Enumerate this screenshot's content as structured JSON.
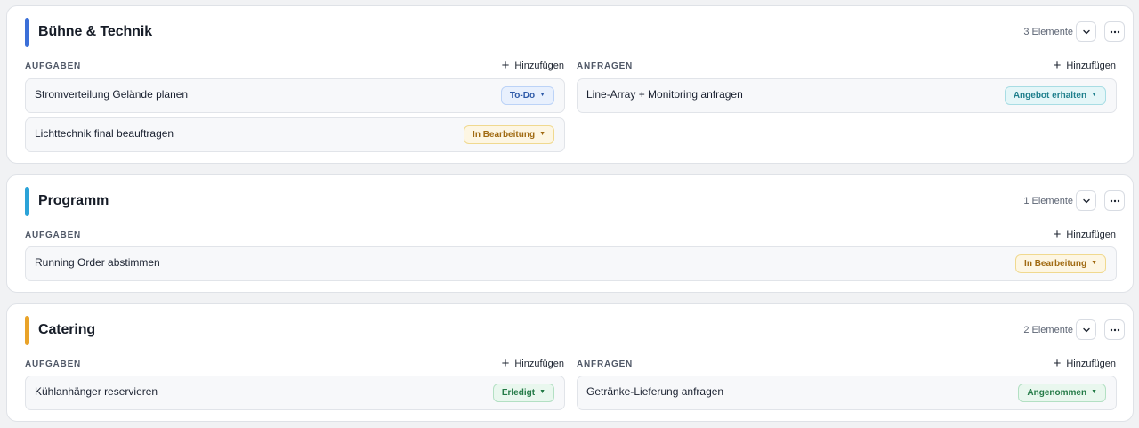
{
  "sections": [
    {
      "title": "Bühne & Technik",
      "accent": "#3b6fd8",
      "count": "3 Elemente",
      "columns": [
        {
          "label": "AUFGABEN",
          "add_label": "Hinzufügen",
          "items": [
            {
              "label": "Stromverteilung Gelände planen",
              "status": "To-Do"
            },
            {
              "label": "Lichttechnik final beauftragen",
              "status": "In Bearbeitung"
            }
          ]
        },
        {
          "label": "ANFRAGEN",
          "add_label": "Hinzufügen",
          "items": [
            {
              "label": "Line-Array + Monitoring anfragen",
              "status": "Angebot erhalten"
            }
          ]
        }
      ]
    },
    {
      "title": "Programm",
      "accent": "#2ba3d8",
      "count": "1 Elemente",
      "columns": [
        {
          "label": "AUFGABEN",
          "add_label": "Hinzufügen",
          "items": [
            {
              "label": "Running Order abstimmen",
              "status": "In Bearbeitung"
            }
          ]
        }
      ]
    },
    {
      "title": "Catering",
      "accent": "#e9a329",
      "count": "2 Elemente",
      "columns": [
        {
          "label": "AUFGABEN",
          "add_label": "Hinzufügen",
          "items": [
            {
              "label": "Kühlanhänger reservieren",
              "status": "Erledigt"
            }
          ]
        },
        {
          "label": "ANFRAGEN",
          "add_label": "Hinzufügen",
          "items": [
            {
              "label": "Getränke-Lieferung anfragen",
              "status": "Angenommen"
            }
          ]
        }
      ]
    }
  ],
  "icons": {
    "collapse": "chevron-down-icon",
    "more": "more-horizontal-icon",
    "add": "plus-icon",
    "badge_dropdown": "chevron-down-icon"
  }
}
